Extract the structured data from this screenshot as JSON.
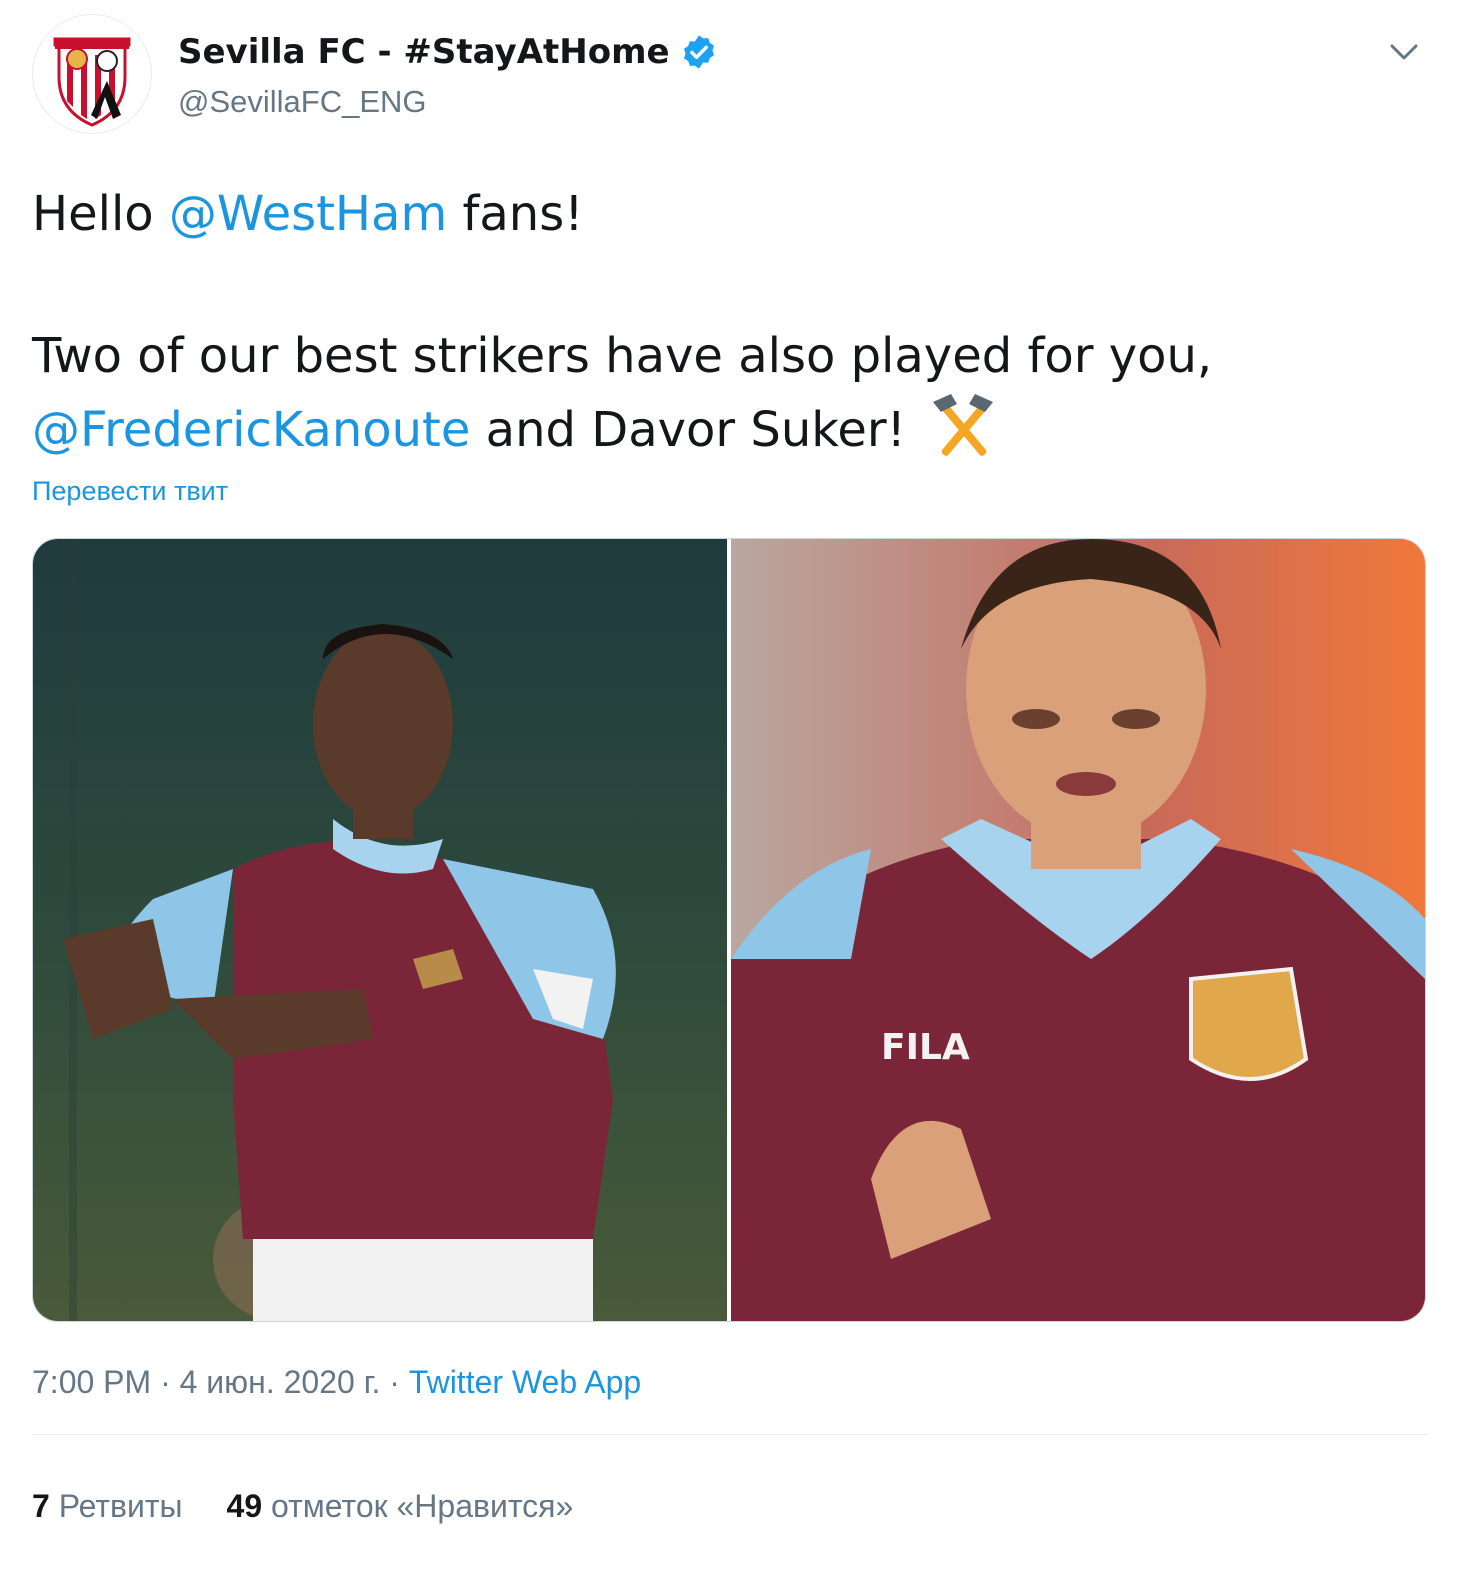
{
  "account": {
    "display_name": "Sevilla FC - #StayAtHome",
    "handle": "@SevillaFC_ENG",
    "verified_icon": "verified-badge-icon",
    "avatar_icon": "sevilla-crest-icon"
  },
  "tweet": {
    "greeting_prefix": "Hello ",
    "mention_1": "@WestHam",
    "greeting_suffix": " fans!",
    "line_2": "Two of our best strikers have also played for you,",
    "mention_2": "@FredericKanoute",
    "line_3_suffix": " and Davor Suker! ",
    "emoji": "hammers-emoji",
    "translate_label": "Перевести твит"
  },
  "meta": {
    "time": "7:00 PM",
    "separator": " · ",
    "date": "4 июн. 2020 г.",
    "app": "Twitter Web App"
  },
  "stats": {
    "retweets_count": "7",
    "retweets_label": " Ретвиты",
    "likes_count": "49",
    "likes_label": " отметок «Нравится»"
  },
  "colors": {
    "link": "#1b95e0",
    "secondary": "#657786",
    "claret": "#7a2638",
    "sky_blue": "#8fc6e8"
  }
}
